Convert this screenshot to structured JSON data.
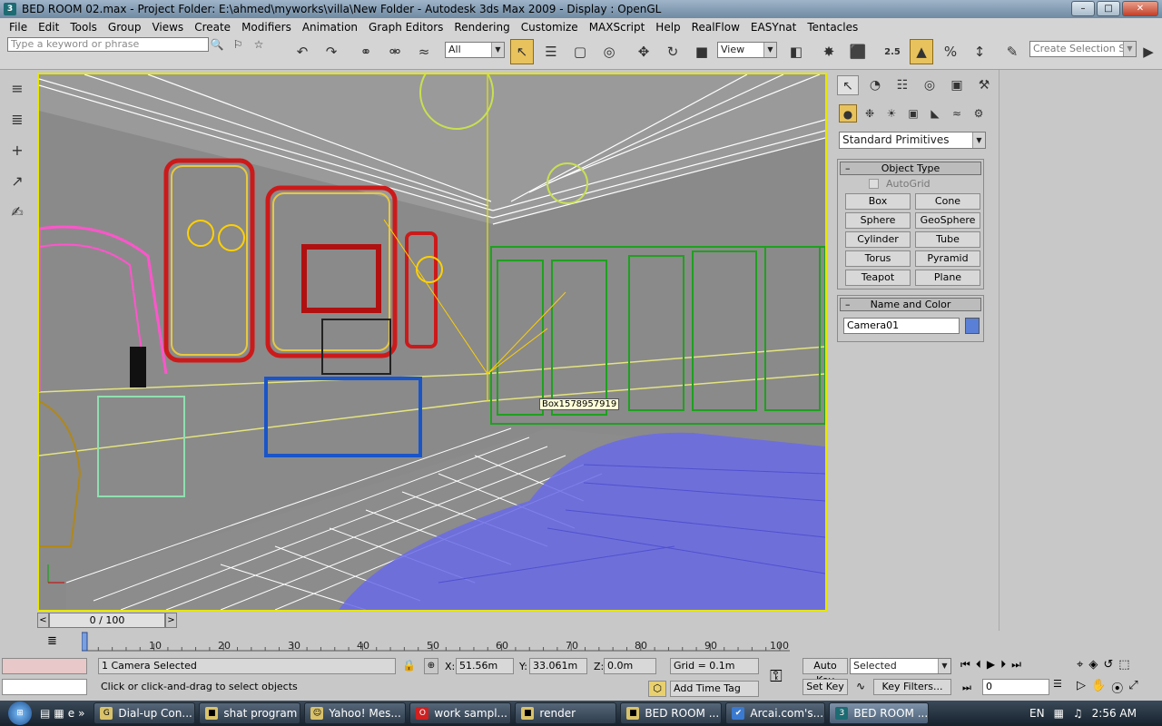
{
  "titlebar": {
    "title": "BED ROOM 02.max     - Project Folder: E:\\ahmed\\myworks\\villa\\New Folder     - Autodesk 3ds Max  2009      - Display : OpenGL",
    "app_icon": "3ds-max-icon"
  },
  "menu": [
    "File",
    "Edit",
    "Tools",
    "Group",
    "Views",
    "Create",
    "Modifiers",
    "Animation",
    "Graph Editors",
    "Rendering",
    "Customize",
    "MAXScript",
    "Help",
    "RealFlow",
    "EASYnat",
    "Tentacles"
  ],
  "toolbar": {
    "keyword_placeholder": "Type a keyword or phrase",
    "filter_value": "All",
    "refcoord_value": "View",
    "snap_value": "2.5",
    "named_selection_placeholder": "Create Selection Set"
  },
  "viewport": {
    "tooltip": "Box1578957919"
  },
  "command_panel": {
    "category": "Standard Primitives",
    "object_type_title": "Object Type",
    "autogrid_label": "AutoGrid",
    "buttons": [
      "Box",
      "Cone",
      "Sphere",
      "GeoSphere",
      "Cylinder",
      "Tube",
      "Torus",
      "Pyramid",
      "Teapot",
      "Plane"
    ],
    "name_color_title": "Name and Color",
    "object_name": "Camera01",
    "object_color": "#5a7fd6"
  },
  "trackbar": {
    "frame": "0 / 100",
    "prev": "<",
    "next": ">"
  },
  "timeline": {
    "ticks": [
      "0",
      "10",
      "20",
      "30",
      "40",
      "50",
      "60",
      "70",
      "80",
      "90",
      "100"
    ]
  },
  "status": {
    "selected_text": "1 Camera Selected",
    "prompt": "Click or click-and-drag to select objects",
    "x_label": "X:",
    "x_value": "51.56m",
    "y_label": "Y:",
    "y_value": "33.061m",
    "z_label": "Z:",
    "z_value": "0.0m",
    "grid": "Grid = 0.1m",
    "add_time_tag": "Add Time Tag",
    "auto_key": "Auto Key",
    "set_key": "Set Key",
    "key_mode": "Selected",
    "key_filters": "Key Filters...",
    "frame_field": "0"
  },
  "taskbar": {
    "items": [
      {
        "label": "Dial-up Con...",
        "icon": "chrome-icon"
      },
      {
        "label": "shat program",
        "icon": "folder-icon"
      },
      {
        "label": "Yahoo! Mes...",
        "icon": "yahoo-icon"
      },
      {
        "label": "work sampl...",
        "icon": "opera-icon"
      },
      {
        "label": "render",
        "icon": "folder-icon"
      },
      {
        "label": "BED ROOM ...",
        "icon": "folder-icon"
      },
      {
        "label": "Arcai.com's...",
        "icon": "arcai-icon"
      },
      {
        "label": "BED ROOM ...",
        "icon": "3ds-max-icon"
      }
    ],
    "language": "EN",
    "clock": "2:56 AM"
  }
}
